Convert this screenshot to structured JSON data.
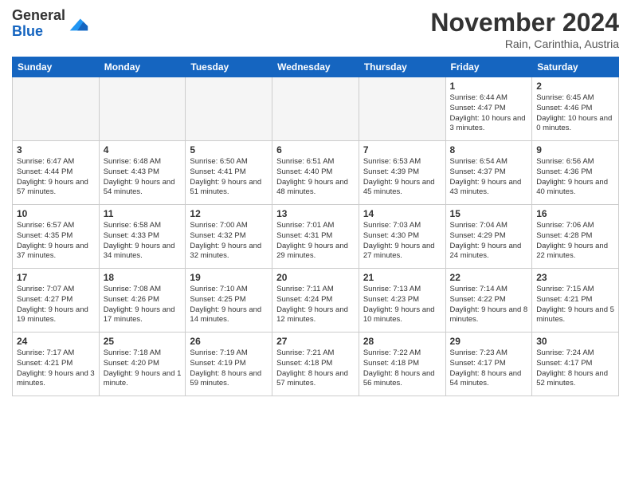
{
  "header": {
    "logo": {
      "general": "General",
      "blue": "Blue"
    },
    "title": "November 2024",
    "location": "Rain, Carinthia, Austria"
  },
  "columns": [
    "Sunday",
    "Monday",
    "Tuesday",
    "Wednesday",
    "Thursday",
    "Friday",
    "Saturday"
  ],
  "weeks": [
    [
      {
        "day": "",
        "empty": true
      },
      {
        "day": "",
        "empty": true
      },
      {
        "day": "",
        "empty": true
      },
      {
        "day": "",
        "empty": true
      },
      {
        "day": "",
        "empty": true
      },
      {
        "day": "1",
        "sunrise": "Sunrise: 6:44 AM",
        "sunset": "Sunset: 4:47 PM",
        "daylight": "Daylight: 10 hours and 3 minutes."
      },
      {
        "day": "2",
        "sunrise": "Sunrise: 6:45 AM",
        "sunset": "Sunset: 4:46 PM",
        "daylight": "Daylight: 10 hours and 0 minutes."
      }
    ],
    [
      {
        "day": "3",
        "sunrise": "Sunrise: 6:47 AM",
        "sunset": "Sunset: 4:44 PM",
        "daylight": "Daylight: 9 hours and 57 minutes."
      },
      {
        "day": "4",
        "sunrise": "Sunrise: 6:48 AM",
        "sunset": "Sunset: 4:43 PM",
        "daylight": "Daylight: 9 hours and 54 minutes."
      },
      {
        "day": "5",
        "sunrise": "Sunrise: 6:50 AM",
        "sunset": "Sunset: 4:41 PM",
        "daylight": "Daylight: 9 hours and 51 minutes."
      },
      {
        "day": "6",
        "sunrise": "Sunrise: 6:51 AM",
        "sunset": "Sunset: 4:40 PM",
        "daylight": "Daylight: 9 hours and 48 minutes."
      },
      {
        "day": "7",
        "sunrise": "Sunrise: 6:53 AM",
        "sunset": "Sunset: 4:39 PM",
        "daylight": "Daylight: 9 hours and 45 minutes."
      },
      {
        "day": "8",
        "sunrise": "Sunrise: 6:54 AM",
        "sunset": "Sunset: 4:37 PM",
        "daylight": "Daylight: 9 hours and 43 minutes."
      },
      {
        "day": "9",
        "sunrise": "Sunrise: 6:56 AM",
        "sunset": "Sunset: 4:36 PM",
        "daylight": "Daylight: 9 hours and 40 minutes."
      }
    ],
    [
      {
        "day": "10",
        "sunrise": "Sunrise: 6:57 AM",
        "sunset": "Sunset: 4:35 PM",
        "daylight": "Daylight: 9 hours and 37 minutes."
      },
      {
        "day": "11",
        "sunrise": "Sunrise: 6:58 AM",
        "sunset": "Sunset: 4:33 PM",
        "daylight": "Daylight: 9 hours and 34 minutes."
      },
      {
        "day": "12",
        "sunrise": "Sunrise: 7:00 AM",
        "sunset": "Sunset: 4:32 PM",
        "daylight": "Daylight: 9 hours and 32 minutes."
      },
      {
        "day": "13",
        "sunrise": "Sunrise: 7:01 AM",
        "sunset": "Sunset: 4:31 PM",
        "daylight": "Daylight: 9 hours and 29 minutes."
      },
      {
        "day": "14",
        "sunrise": "Sunrise: 7:03 AM",
        "sunset": "Sunset: 4:30 PM",
        "daylight": "Daylight: 9 hours and 27 minutes."
      },
      {
        "day": "15",
        "sunrise": "Sunrise: 7:04 AM",
        "sunset": "Sunset: 4:29 PM",
        "daylight": "Daylight: 9 hours and 24 minutes."
      },
      {
        "day": "16",
        "sunrise": "Sunrise: 7:06 AM",
        "sunset": "Sunset: 4:28 PM",
        "daylight": "Daylight: 9 hours and 22 minutes."
      }
    ],
    [
      {
        "day": "17",
        "sunrise": "Sunrise: 7:07 AM",
        "sunset": "Sunset: 4:27 PM",
        "daylight": "Daylight: 9 hours and 19 minutes."
      },
      {
        "day": "18",
        "sunrise": "Sunrise: 7:08 AM",
        "sunset": "Sunset: 4:26 PM",
        "daylight": "Daylight: 9 hours and 17 minutes."
      },
      {
        "day": "19",
        "sunrise": "Sunrise: 7:10 AM",
        "sunset": "Sunset: 4:25 PM",
        "daylight": "Daylight: 9 hours and 14 minutes."
      },
      {
        "day": "20",
        "sunrise": "Sunrise: 7:11 AM",
        "sunset": "Sunset: 4:24 PM",
        "daylight": "Daylight: 9 hours and 12 minutes."
      },
      {
        "day": "21",
        "sunrise": "Sunrise: 7:13 AM",
        "sunset": "Sunset: 4:23 PM",
        "daylight": "Daylight: 9 hours and 10 minutes."
      },
      {
        "day": "22",
        "sunrise": "Sunrise: 7:14 AM",
        "sunset": "Sunset: 4:22 PM",
        "daylight": "Daylight: 9 hours and 8 minutes."
      },
      {
        "day": "23",
        "sunrise": "Sunrise: 7:15 AM",
        "sunset": "Sunset: 4:21 PM",
        "daylight": "Daylight: 9 hours and 5 minutes."
      }
    ],
    [
      {
        "day": "24",
        "sunrise": "Sunrise: 7:17 AM",
        "sunset": "Sunset: 4:21 PM",
        "daylight": "Daylight: 9 hours and 3 minutes."
      },
      {
        "day": "25",
        "sunrise": "Sunrise: 7:18 AM",
        "sunset": "Sunset: 4:20 PM",
        "daylight": "Daylight: 9 hours and 1 minute."
      },
      {
        "day": "26",
        "sunrise": "Sunrise: 7:19 AM",
        "sunset": "Sunset: 4:19 PM",
        "daylight": "Daylight: 8 hours and 59 minutes."
      },
      {
        "day": "27",
        "sunrise": "Sunrise: 7:21 AM",
        "sunset": "Sunset: 4:18 PM",
        "daylight": "Daylight: 8 hours and 57 minutes."
      },
      {
        "day": "28",
        "sunrise": "Sunrise: 7:22 AM",
        "sunset": "Sunset: 4:18 PM",
        "daylight": "Daylight: 8 hours and 56 minutes."
      },
      {
        "day": "29",
        "sunrise": "Sunrise: 7:23 AM",
        "sunset": "Sunset: 4:17 PM",
        "daylight": "Daylight: 8 hours and 54 minutes."
      },
      {
        "day": "30",
        "sunrise": "Sunrise: 7:24 AM",
        "sunset": "Sunset: 4:17 PM",
        "daylight": "Daylight: 8 hours and 52 minutes."
      }
    ]
  ]
}
